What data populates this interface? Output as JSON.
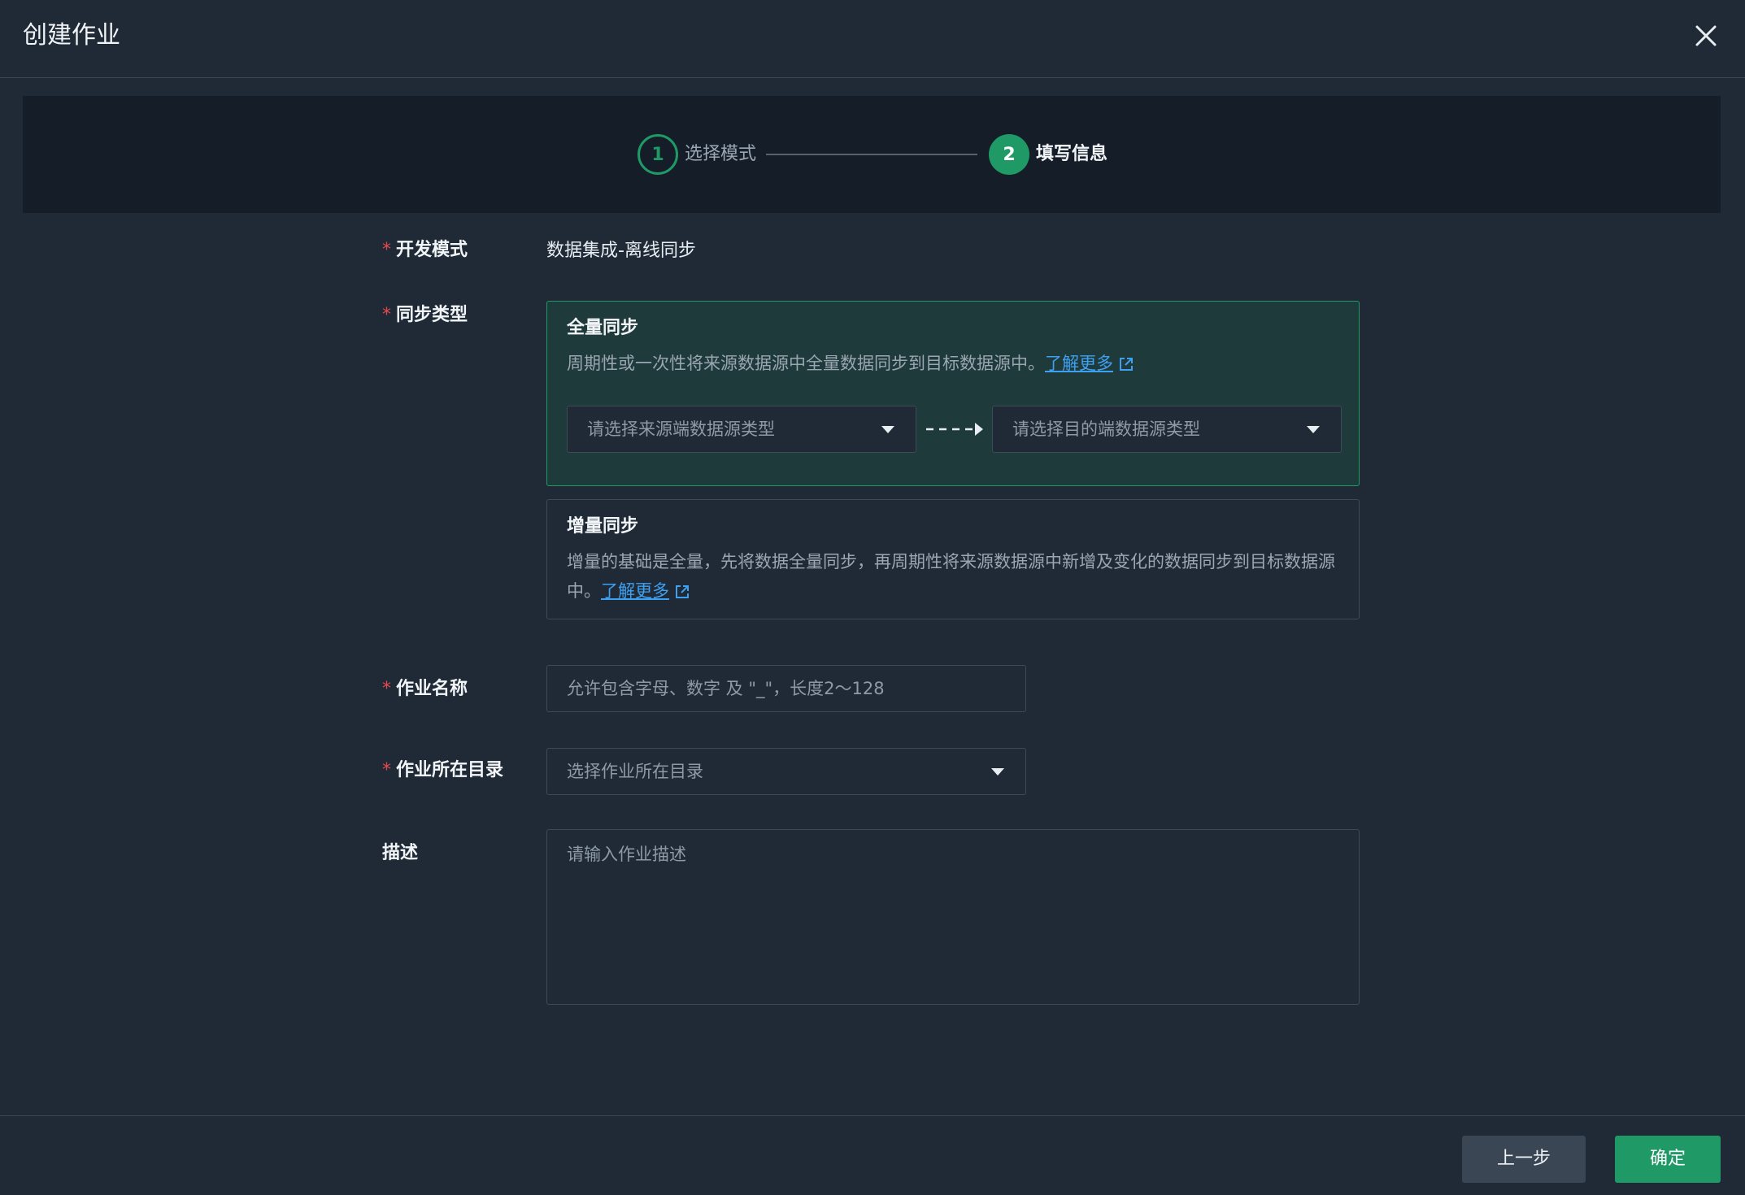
{
  "dialog": {
    "title": "创建作业"
  },
  "steps": [
    {
      "number": "1",
      "label": "选择模式"
    },
    {
      "number": "2",
      "label": "填写信息"
    }
  ],
  "form": {
    "dev_mode": {
      "label": "开发模式",
      "value": "数据集成-离线同步"
    },
    "sync_type": {
      "label": "同步类型",
      "full": {
        "title": "全量同步",
        "desc": "周期性或一次性将来源数据源中全量数据同步到目标数据源中。",
        "link": "了解更多",
        "source_placeholder": "请选择来源端数据源类型",
        "target_placeholder": "请选择目的端数据源类型"
      },
      "incremental": {
        "title": "增量同步",
        "desc": "增量的基础是全量，先将数据全量同步，再周期性将来源数据源中新增及变化的数据同步到目标数据源中。",
        "link": "了解更多"
      }
    },
    "job_name": {
      "label": "作业名称",
      "placeholder": "允许包含字母、数字 及 \"_\"，长度2～128"
    },
    "job_dir": {
      "label": "作业所在目录",
      "placeholder": "选择作业所在目录"
    },
    "description": {
      "label": "描述",
      "placeholder": "请输入作业描述"
    }
  },
  "footer": {
    "prev_label": "上一步",
    "ok_label": "确定"
  },
  "colors": {
    "accent": "#1f9a66",
    "link": "#3ea0f0",
    "required": "#e5484d",
    "background": "#1f2a36"
  },
  "icons": {
    "close": "close-icon",
    "caret": "chevron-down-icon",
    "external": "external-link-icon",
    "flow": "arrow-right-icon"
  }
}
